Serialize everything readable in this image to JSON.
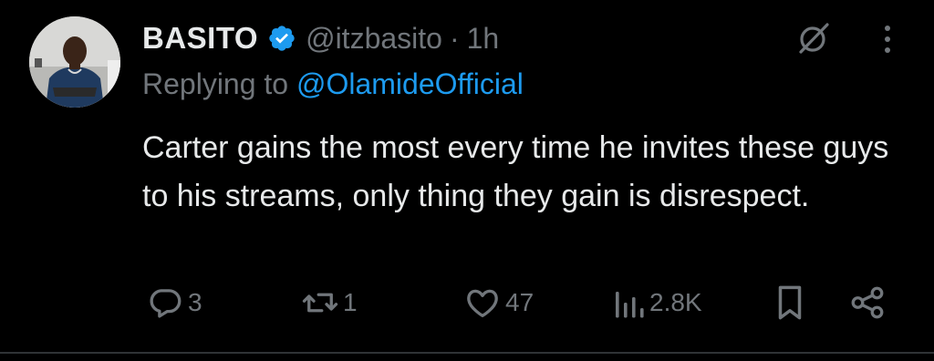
{
  "tweet": {
    "author_name": "BASITO",
    "handle": "@itzbasito",
    "separator": "·",
    "time": "1h",
    "replying_prefix": "Replying to",
    "replying_to": "@OlamideOfficial",
    "body": "Carter gains the most every time he invites these guys to his streams, only thing they gain is disrespect."
  },
  "actions": {
    "replies": "3",
    "reposts": "1",
    "likes": "47",
    "views": "2.8K"
  },
  "icons": {
    "verified": "verified-badge-icon",
    "grok": "grok-icon",
    "more": "more-vertical-icon",
    "reply": "reply-icon",
    "repost": "repost-icon",
    "like": "heart-icon",
    "views": "views-bar-chart-icon",
    "bookmark": "bookmark-icon",
    "share": "share-icon"
  },
  "colors": {
    "background": "#000000",
    "text": "#e7e9ea",
    "muted": "#71767b",
    "accent": "#1d9bf0"
  }
}
